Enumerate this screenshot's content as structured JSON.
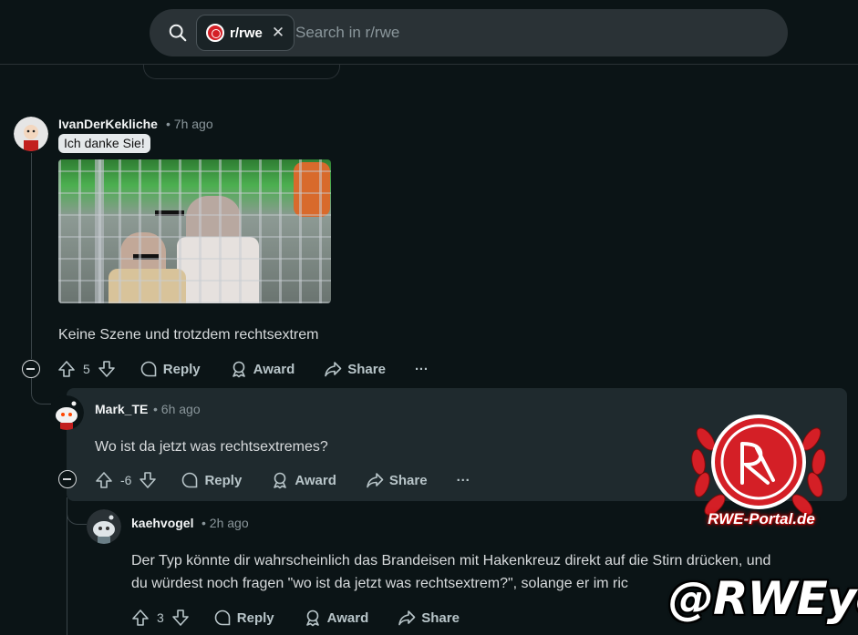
{
  "search": {
    "subreddit": "r/rwe",
    "placeholder": "Search in r/rwe"
  },
  "comments": [
    {
      "user": "IvanDerKekliche",
      "time": "7h ago",
      "flair": "Ich danke Sie!",
      "text": "Keine Szene und trotzdem rechtsextrem",
      "score": "5",
      "actions": {
        "reply": "Reply",
        "award": "Award",
        "share": "Share",
        "more": "···"
      }
    },
    {
      "user": "Mark_TE",
      "time": "6h ago",
      "text": "Wo ist da jetzt was rechtsextremes?",
      "score": "-6",
      "actions": {
        "reply": "Reply",
        "award": "Award",
        "share": "Share",
        "more": "···"
      }
    },
    {
      "user": "kaehvogel",
      "time": "2h ago",
      "text_line1": "Der Typ könnte dir wahrscheinlich das Brandeisen mit Hakenkreuz direkt auf die Stirn drücken, und",
      "text_line2": "du würdest noch fragen \"wo ist da jetzt was rechtsextrem?\", solange er im ric",
      "score": "3",
      "actions": {
        "reply": "Reply",
        "award": "Award",
        "share": "Share"
      }
    }
  ],
  "watermark": {
    "portal": "RWE-Portal.de",
    "handle": "@RWEye"
  },
  "colors": {
    "background": "#0b1416",
    "highlight": "#1f2a2e",
    "brand_red": "#d41f26"
  }
}
